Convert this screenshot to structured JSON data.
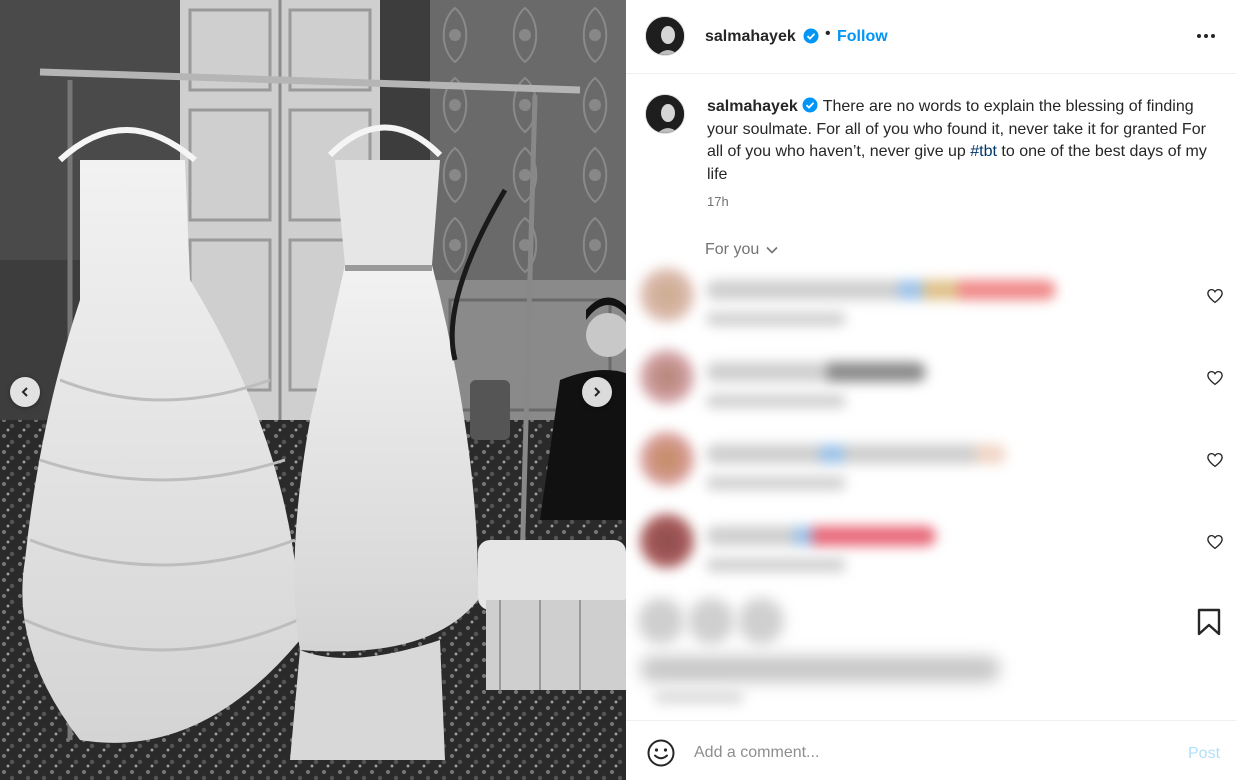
{
  "post": {
    "photo_alt": "",
    "username": "salmahayek",
    "verified_icon": "verified-badge-icon",
    "separator": "•",
    "follow_label": "Follow",
    "more_icon": "more-options-icon"
  },
  "caption": {
    "username": "salmahayek",
    "text_part1": "There are no words to explain the blessing of finding your soulmate. For all of you who found it, never take it for granted For all of you who haven’t, never give up ",
    "hashtag": "#tbt",
    "text_part2": " to one of the best days of my life",
    "time": "17h"
  },
  "comments_filter": {
    "label": "For you"
  },
  "comments": [
    {
      "blurred": true
    },
    {
      "blurred": true
    },
    {
      "blurred": true
    },
    {
      "blurred": true
    }
  ],
  "comment_box": {
    "placeholder": "Add a comment...",
    "post_label": "Post"
  },
  "colors": {
    "accent": "#0095f6",
    "hashtag": "#00376b",
    "muted": "#737373",
    "post_disabled": "#b2dffc"
  }
}
